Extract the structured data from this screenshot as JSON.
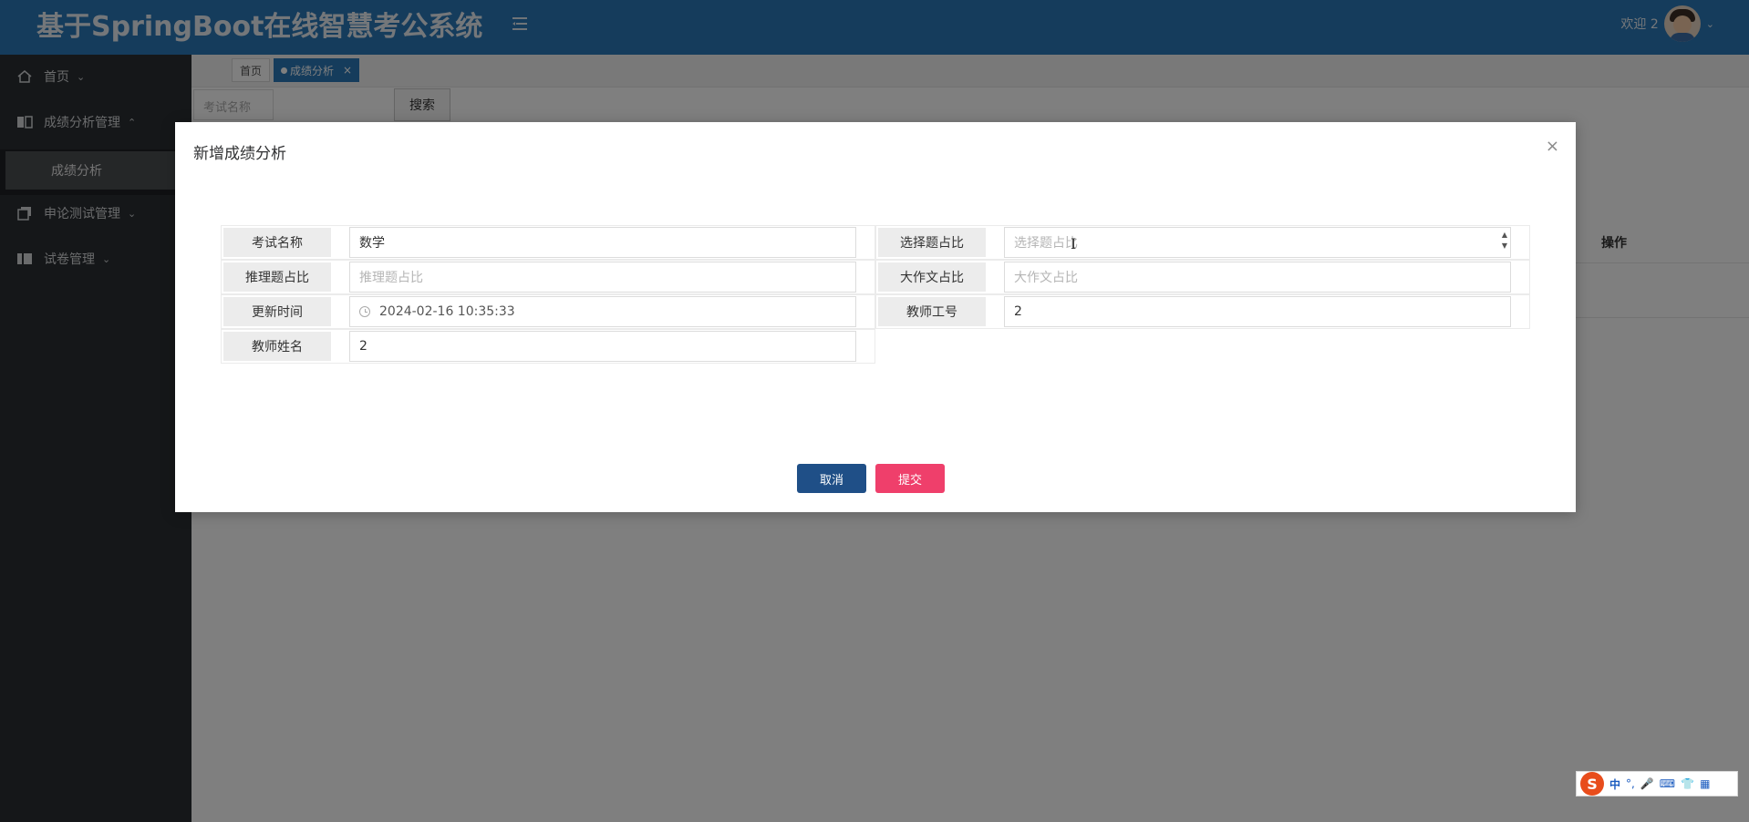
{
  "app": {
    "title": "基于SpringBoot在线智慧考公系统"
  },
  "header": {
    "welcome": "欢迎 2"
  },
  "sidebar": {
    "items": [
      {
        "label": "首页"
      },
      {
        "label": "成绩分析管理"
      },
      {
        "label": "成绩分析"
      },
      {
        "label": "申论测试管理"
      },
      {
        "label": "试卷管理"
      }
    ]
  },
  "tabs": {
    "home": "首页",
    "active": "成绩分析",
    "close": "×"
  },
  "search": {
    "placeholder": "考试名称",
    "button": "搜索"
  },
  "table": {
    "op_header": "操作"
  },
  "modal": {
    "title": "新增成绩分析",
    "close": "×",
    "fields": {
      "exam_name": {
        "label": "考试名称",
        "value": "数学"
      },
      "choice_ratio": {
        "label": "选择题占比",
        "placeholder": "选择题占比"
      },
      "reasoning_ratio": {
        "label": "推理题占比",
        "placeholder": "推理题占比"
      },
      "essay_ratio": {
        "label": "大作文占比",
        "placeholder": "大作文占比"
      },
      "update_time": {
        "label": "更新时间",
        "value": "2024-02-16 10:35:33"
      },
      "teacher_id": {
        "label": "教师工号",
        "value": "2"
      },
      "teacher_name": {
        "label": "教师姓名",
        "value": "2"
      }
    },
    "cancel": "取消",
    "submit": "提交"
  },
  "ime": {
    "lang": "中",
    "punct": "°,"
  }
}
